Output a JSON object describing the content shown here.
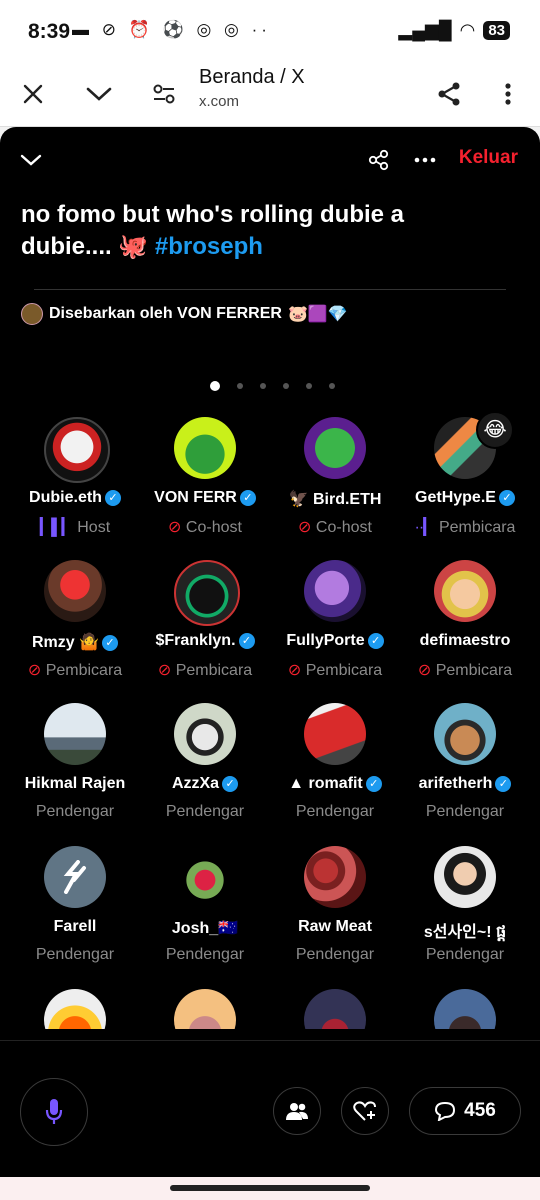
{
  "status_bar": {
    "time": "8:39",
    "battery": "83"
  },
  "browser": {
    "title": "Beranda / X",
    "url": "x.com"
  },
  "space": {
    "leave_label": "Keluar",
    "title_text": "no fomo but who's rolling dubie a dubie.... 🐙 ",
    "hashtag": "#broseph",
    "shared_by": "Disebarkan oleh VON FERRER",
    "shared_by_emoji": "🐷🟪💎"
  },
  "participants": [
    {
      "name": "Dubie.eth",
      "role": "Host",
      "verified": true
    },
    {
      "name": "VON FERR",
      "role": "Co-host",
      "verified": true
    },
    {
      "name": "🦅 Bird.ETH",
      "role": "Co-host",
      "verified": false
    },
    {
      "name": "GetHype.E",
      "role": "Pembicara",
      "verified": true
    },
    {
      "name": "Rmzy 🤷",
      "role": "Pembicara",
      "verified": true
    },
    {
      "name": "$Franklyn.",
      "role": "Pembicara",
      "verified": true
    },
    {
      "name": "FullyPorte",
      "role": "Pembicara",
      "verified": true
    },
    {
      "name": "defimaestro",
      "role": "Pembicara",
      "verified": false
    },
    {
      "name": "Hikmal Rajen",
      "role": "Pendengar",
      "verified": false
    },
    {
      "name": "AzzXa",
      "role": "Pendengar",
      "verified": true
    },
    {
      "name": "▲ romafit",
      "role": "Pendengar",
      "verified": true
    },
    {
      "name": "arifetherh",
      "role": "Pendengar",
      "verified": true
    },
    {
      "name": "Farell",
      "role": "Pendengar",
      "verified": false
    },
    {
      "name": "Josh_🇦🇺",
      "role": "Pendengar",
      "verified": false
    },
    {
      "name": "Raw Meat",
      "role": "Pendengar",
      "verified": false
    },
    {
      "name": "s선사인~! ផ្ដ",
      "role": "Pendengar",
      "verified": false
    }
  ],
  "comment_count": "456",
  "colors": {
    "accent_blue": "#1d9bf0",
    "leave_red": "#f4212e",
    "host_purple": "#7856ff",
    "sheet_bg": "#000000"
  },
  "icons": [
    "close-icon",
    "chevron-down-icon",
    "site-settings-icon",
    "share-icon",
    "more-vert-icon",
    "space-share-icon",
    "more-horiz-icon",
    "mic-icon",
    "people-icon",
    "heart-plus-icon",
    "comment-icon"
  ]
}
